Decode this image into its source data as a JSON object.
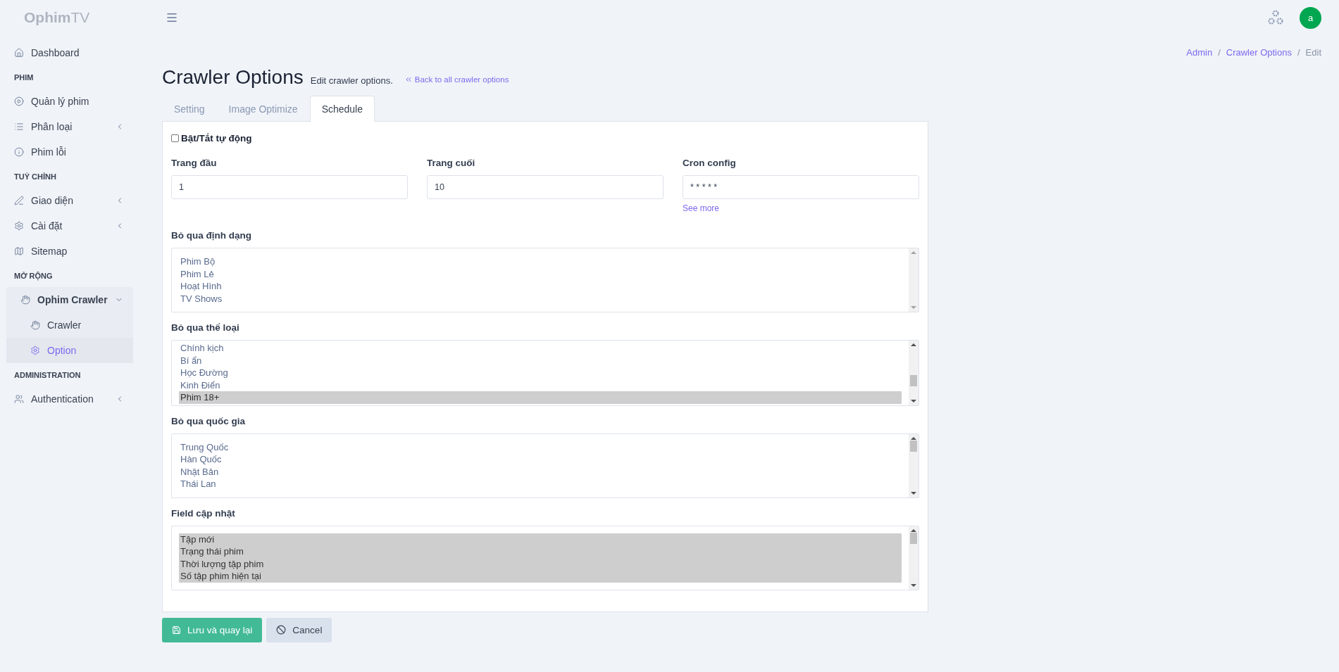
{
  "brand": {
    "strong": "Ophim",
    "light": "TV"
  },
  "user": {
    "initial": "a"
  },
  "breadcrumbs": [
    {
      "label": "Admin",
      "kind": "link"
    },
    {
      "label": "/",
      "kind": "separator"
    },
    {
      "label": "Crawler Options",
      "kind": "link"
    },
    {
      "label": "/",
      "kind": "separator"
    },
    {
      "label": "Edit",
      "kind": "current"
    }
  ],
  "sidebar": {
    "sections": [
      {
        "items": [
          {
            "label": "Dashboard",
            "caret": false,
            "selected": false
          }
        ]
      },
      {
        "heading": "PHIM",
        "items": [
          {
            "label": "Quản lý phim",
            "caret": false,
            "selected": false
          },
          {
            "label": "Phân loại",
            "caret": true,
            "selected": false
          },
          {
            "label": "Phim lỗi",
            "caret": false,
            "selected": false
          }
        ]
      },
      {
        "heading": "TUỲ CHỈNH",
        "items": [
          {
            "label": "Giao diện",
            "caret": true,
            "selected": false
          },
          {
            "label": "Cài đặt",
            "caret": true,
            "selected": false
          },
          {
            "label": "Sitemap",
            "caret": false,
            "selected": false
          }
        ]
      },
      {
        "heading": "MỞ RỘNG",
        "items": [
          {
            "label": "Ophim Crawler",
            "caret": true,
            "selected": false,
            "expanded": true,
            "children": [
              {
                "label": "Crawler",
                "selected": false
              },
              {
                "label": "Option",
                "selected": true
              }
            ]
          }
        ]
      },
      {
        "heading": "ADMINISTRATION",
        "items": [
          {
            "label": "Authentication",
            "caret": true,
            "selected": false
          }
        ]
      }
    ]
  },
  "page": {
    "title": "Crawler Options",
    "subtitle": "Edit crawler options.",
    "back_link": "Back to all crawler options"
  },
  "tabs": [
    {
      "label": "Setting",
      "selected": false
    },
    {
      "label": "Image Optimize",
      "selected": false
    },
    {
      "label": "Schedule",
      "selected": true
    }
  ],
  "form": {
    "toggle": {
      "label": "Bật/Tắt tự động",
      "checked": false
    },
    "fields": [
      {
        "label": "Trang đầu",
        "value": "1"
      },
      {
        "label": "Trang cuối",
        "value": "10"
      },
      {
        "label": "Cron config",
        "value": "* * * * *",
        "help": "See more"
      }
    ],
    "lists": [
      {
        "label": "Bỏ qua định dạng",
        "options": [
          {
            "text": "Phim Bộ",
            "selected": false
          },
          {
            "text": "Phim Lẻ",
            "selected": false
          },
          {
            "text": "Hoạt Hình",
            "selected": false
          },
          {
            "text": "TV Shows",
            "selected": false
          }
        ]
      },
      {
        "label": "Bỏ qua thể loại",
        "options": [
          {
            "text": "Chính kịch",
            "selected": false
          },
          {
            "text": "Bí ẩn",
            "selected": false
          },
          {
            "text": "Học Đường",
            "selected": false
          },
          {
            "text": "Kinh Điển",
            "selected": false
          },
          {
            "text": "Phim 18+",
            "selected": true
          }
        ]
      },
      {
        "label": "Bỏ qua quốc gia",
        "options": [
          {
            "text": "Trung Quốc",
            "selected": false
          },
          {
            "text": "Hàn Quốc",
            "selected": false
          },
          {
            "text": "Nhật Bản",
            "selected": false
          },
          {
            "text": "Thái Lan",
            "selected": false
          }
        ]
      },
      {
        "label": "Field cập nhật",
        "options": [
          {
            "text": "Tập mới",
            "selected": true
          },
          {
            "text": "Trạng thái phim",
            "selected": true
          },
          {
            "text": "Thời lượng tập phim",
            "selected": true
          },
          {
            "text": "Số tập phim hiện tại",
            "selected": true
          }
        ]
      }
    ]
  },
  "buttons": [
    {
      "label": "Lưu và quay lại",
      "kind": "primary"
    },
    {
      "label": "Cancel",
      "kind": "secondary"
    }
  ]
}
